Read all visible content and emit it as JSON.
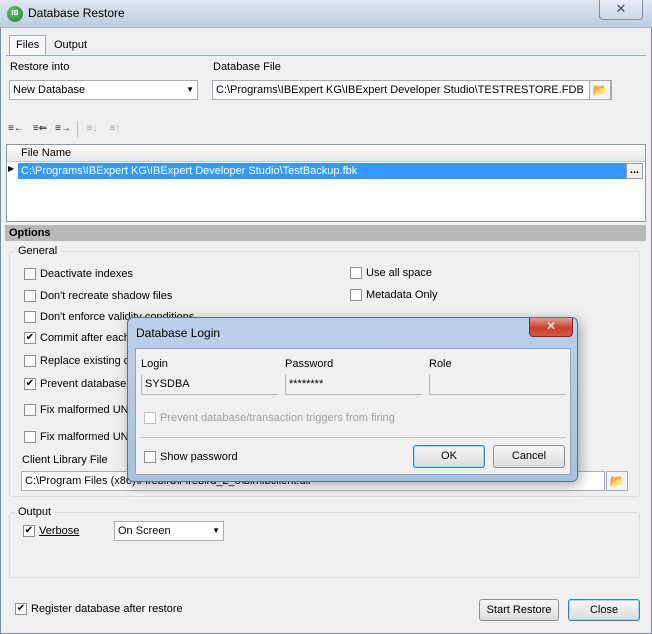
{
  "window": {
    "title": "Database Restore",
    "close_glyph": "✕"
  },
  "tabs": [
    {
      "label": "Files"
    },
    {
      "label": "Output"
    }
  ],
  "files": {
    "restore_into_label": "Restore into",
    "restore_into_value": "New Database",
    "database_file_label": "Database File",
    "database_file_value": "C:\\Programs\\IBExpert KG\\IBExpert Developer Studio\\TESTRESTORE.FDB",
    "grid_header": "File Name",
    "grid_rows": [
      "C:\\Programs\\IBExpert KG\\IBExpert Developer Studio\\TestBackup.fbk"
    ],
    "row_ellipsis": "..."
  },
  "options": {
    "section_label": "Options",
    "general_label": "General",
    "left": [
      {
        "label": "Deactivate indexes",
        "checked": false
      },
      {
        "label": "Don't recreate shadow files",
        "checked": false
      },
      {
        "label": "Don't enforce validity conditions",
        "checked": false
      },
      {
        "label": "Commit after each",
        "checked": true
      },
      {
        "label": "Replace existing d",
        "checked": false
      },
      {
        "label": "Prevent database",
        "checked": true
      },
      {
        "label": "Fix malformed UNI",
        "checked": false
      },
      {
        "label": "Fix malformed UNI",
        "checked": false
      }
    ],
    "right": [
      {
        "label": "Use all space",
        "checked": false
      },
      {
        "label": "Metadata Only",
        "checked": false
      }
    ],
    "client_library_label": "Client Library File",
    "client_library_value": "C:\\Program Files (x86)\\Firebird\\Firebird_2_5\\bin\\fbclient.dll"
  },
  "output": {
    "group_label": "Output",
    "verbose_label": "Verbose",
    "verbose_checked": true,
    "verbose_target": "On Screen"
  },
  "footer": {
    "register_label": "Register database after restore",
    "register_checked": true,
    "start_label": "Start Restore",
    "close_label": "Close"
  },
  "login_dialog": {
    "title": "Database Login",
    "close_glyph": "✕",
    "login_label": "Login",
    "login_value": "SYSDBA",
    "password_label": "Password",
    "password_value": "********",
    "role_label": "Role",
    "role_value": "",
    "triggers_label": "Prevent database/transaction triggers from firing",
    "show_password_label": "Show password",
    "ok_label": "OK",
    "cancel_label": "Cancel"
  },
  "icons": {
    "app": "ibexpert-logo-icon",
    "folder": "folder-open-icon",
    "toolbar": [
      "add-file-icon",
      "insert-file-icon",
      "append-file-icon",
      "move-down-icon",
      "move-up-icon"
    ]
  },
  "colors": {
    "selection": "#3399ff",
    "section_bar": "#b8b8b8",
    "dialog_frame": "#a9c1de",
    "dialog_close": "#c7412e"
  }
}
